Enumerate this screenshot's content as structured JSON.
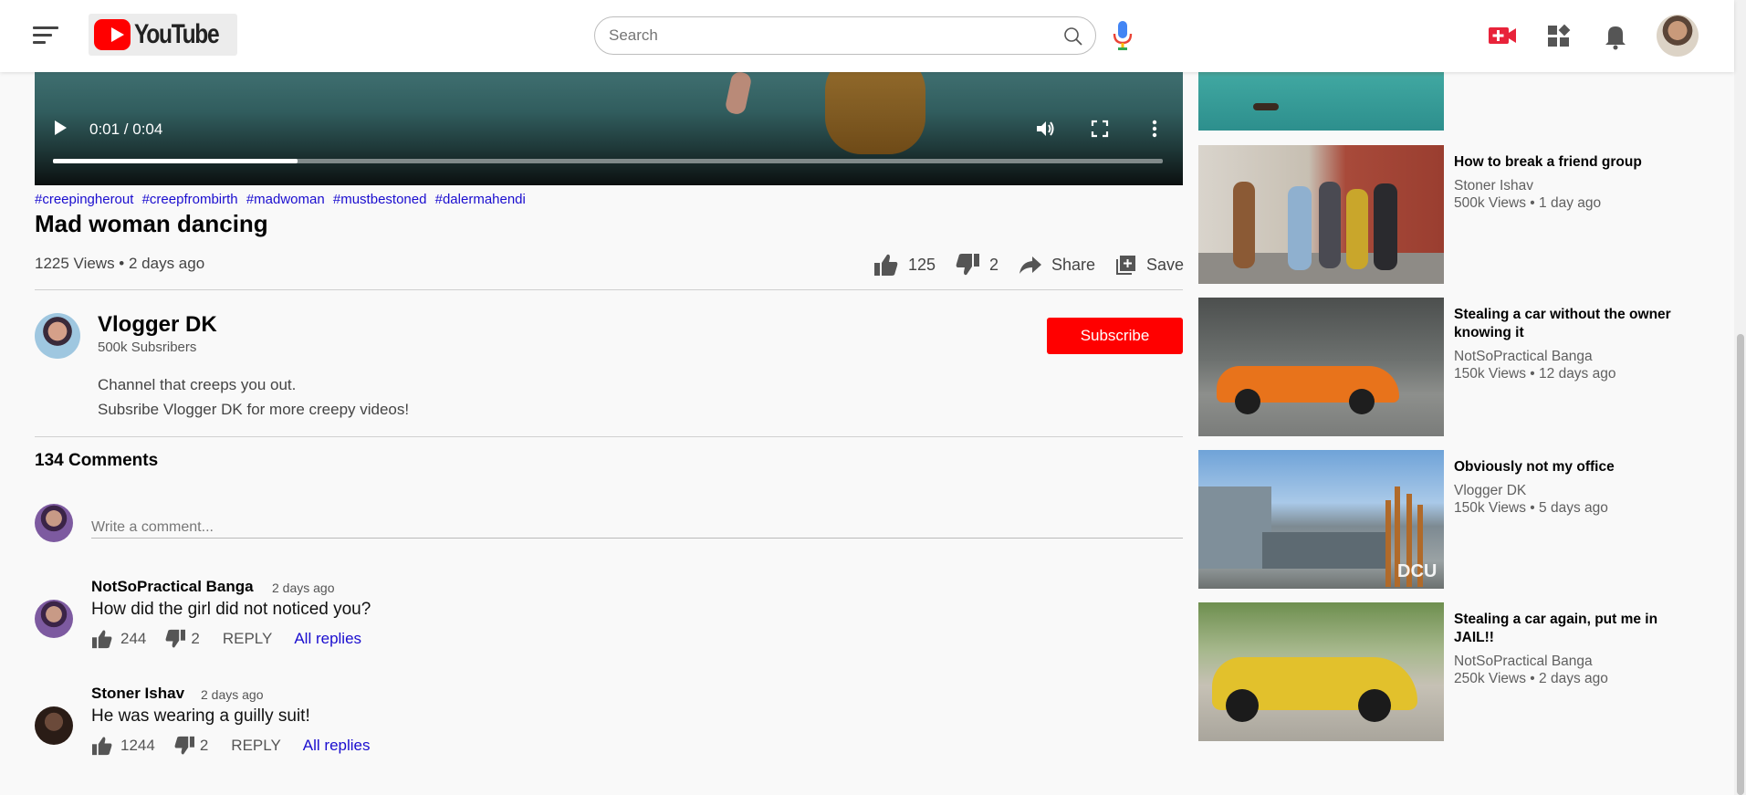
{
  "header": {
    "logo_text": "YouTube",
    "search_placeholder": "Search"
  },
  "icons": {
    "menu": "hamburger-menu-icon",
    "search": "search-icon",
    "mic": "mic-icon",
    "create": "create-video-icon",
    "apps": "apps-icon",
    "notifications": "bell-icon"
  },
  "video": {
    "time": "0:01 / 0:04",
    "progress_fraction": 0.22
  },
  "info": {
    "hashtags": [
      "#creepingherout",
      "#creepfrombirth",
      "#madwoman",
      "#mustbestoned",
      "#dalermahendi"
    ],
    "title": "Mad woman dancing",
    "meta": "1225 Views • 2 days ago",
    "likes": "125",
    "dislikes": "2",
    "share": "Share",
    "save": "Save"
  },
  "channel": {
    "name": "Vlogger DK",
    "subs": "500k Subsribers",
    "subscribe_label": "Subscribe",
    "desc_line1": "Channel that creeps you out.",
    "desc_line2": "Subsribe Vlogger DK for more creepy videos!"
  },
  "comments": {
    "count_label": "134 Comments",
    "input_placeholder": "Write a comment...",
    "items": [
      {
        "author": "NotSoPractical Banga",
        "time": "2 days ago",
        "text": "How did the girl did not noticed you?",
        "likes": "244",
        "dislikes": "2",
        "reply": "REPLY",
        "all_replies": "All replies"
      },
      {
        "author": "Stoner Ishav",
        "time": "2 days ago",
        "text": "He was wearing a guilly suit!",
        "likes": "1244",
        "dislikes": "2",
        "reply": "REPLY",
        "all_replies": "All replies"
      }
    ]
  },
  "sidebar": [
    {
      "title": "",
      "channel": "",
      "meta": ""
    },
    {
      "title": "How to break a friend group",
      "channel": "Stoner Ishav",
      "meta": "500k Views • 1 day ago"
    },
    {
      "title": "Stealing a car without the owner knowing it",
      "channel": "NotSoPractical Banga",
      "meta": "150k Views • 12 days ago"
    },
    {
      "title": "Obviously not my office",
      "channel": "Vlogger DK",
      "meta": "150k Views • 5 days ago"
    },
    {
      "title": "Stealing a car again, put me in JAIL!!",
      "channel": "NotSoPractical Banga",
      "meta": "250k Views • 2 days ago"
    }
  ],
  "thumb_text": {
    "office_sign": "DCU"
  },
  "colors": {
    "brand_red": "#ff0000",
    "link_blue": "#1a0dcf"
  }
}
